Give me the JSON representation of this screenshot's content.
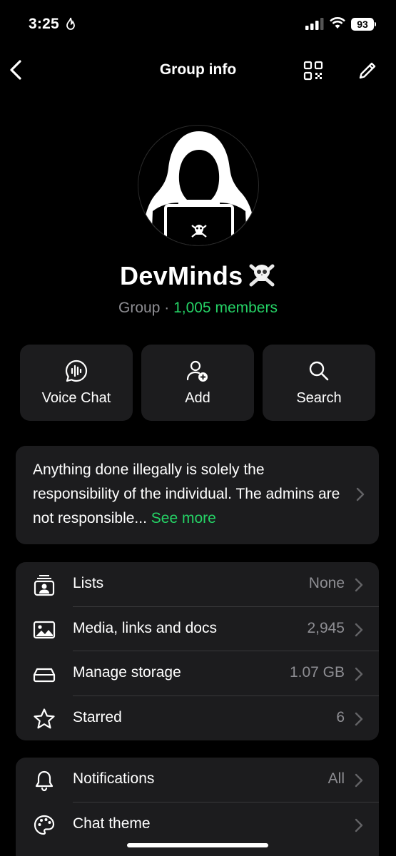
{
  "status_bar": {
    "time": "3:25",
    "battery": "93"
  },
  "nav": {
    "title": "Group info"
  },
  "group": {
    "name": "DevMinds",
    "type_label": "Group",
    "separator": " · ",
    "members": "1,005 members"
  },
  "actions": [
    {
      "label": "Voice Chat",
      "icon": "voice-chat-icon"
    },
    {
      "label": "Add",
      "icon": "add-member-icon"
    },
    {
      "label": "Search",
      "icon": "search-icon"
    }
  ],
  "description": {
    "text": "Anything done illegally is solely the responsibility of the individual. The admins are not responsible...",
    "see_more": "See more"
  },
  "info_rows": [
    {
      "label": "Lists",
      "value": "None",
      "icon": "lists-icon"
    },
    {
      "label": "Media, links and docs",
      "value": "2,945",
      "icon": "media-icon"
    },
    {
      "label": "Manage storage",
      "value": "1.07 GB",
      "icon": "storage-icon"
    },
    {
      "label": "Starred",
      "value": "6",
      "icon": "star-icon"
    }
  ],
  "settings_rows": [
    {
      "label": "Notifications",
      "value": "All",
      "icon": "bell-icon"
    },
    {
      "label": "Chat theme",
      "value": "",
      "icon": "palette-icon"
    }
  ],
  "colors": {
    "accent": "#25d366",
    "card": "#1c1c1e",
    "muted": "#8e8e93"
  }
}
